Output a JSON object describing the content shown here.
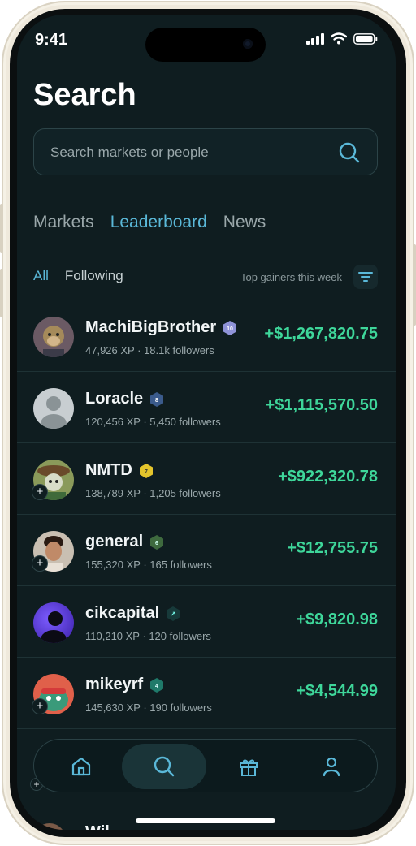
{
  "status": {
    "time": "9:41"
  },
  "page": {
    "title": "Search"
  },
  "search": {
    "placeholder": "Search markets or people"
  },
  "tabs": [
    {
      "label": "Markets",
      "active": false
    },
    {
      "label": "Leaderboard",
      "active": true
    },
    {
      "label": "News",
      "active": false
    }
  ],
  "filters": [
    {
      "label": "All",
      "active": true
    },
    {
      "label": "Following",
      "active": false
    }
  ],
  "sort": {
    "label": "Top gainers this week"
  },
  "leaderboard": [
    {
      "name": "MachiBigBrother",
      "badge": "10",
      "badge_color": "#8f93d8",
      "xp": "47,926 XP",
      "followers": "18.1k followers",
      "gain": "+$1,267,820.75",
      "avatar_color": "#6b5a64",
      "follow_button": false
    },
    {
      "name": "Loracle",
      "badge": "8",
      "badge_color": "#3b5b8c",
      "xp": "120,456 XP",
      "followers": "5,450 followers",
      "gain": "+$1,115,570.50",
      "avatar_color": "#c8ced1",
      "follow_button": false
    },
    {
      "name": "NMTD",
      "badge": "7",
      "badge_color": "#e4c52c",
      "xp": "138,789 XP",
      "followers": "1,205 followers",
      "gain": "+$922,320.78",
      "avatar_color": "#8a9a5a",
      "follow_button": true
    },
    {
      "name": "general",
      "badge": "6",
      "badge_color": "#3e6a3e",
      "xp": "155,320 XP",
      "followers": "165 followers",
      "gain": "+$12,755.75",
      "avatar_color": "#b58566",
      "follow_button": true
    },
    {
      "name": "cikcapital",
      "badge": "↗",
      "badge_color": "#173a3a",
      "xp": "110,210 XP",
      "followers": "120 followers",
      "gain": "+$9,820.98",
      "avatar_color": "#5b3de0",
      "follow_button": false
    },
    {
      "name": "mikeyrf",
      "badge": "4",
      "badge_color": "#1f7a6a",
      "xp": "145,630 XP",
      "followers": "190 followers",
      "gain": "+$4,544.99",
      "avatar_color": "#e0604a",
      "follow_button": true
    }
  ],
  "nav": [
    {
      "icon": "home-icon",
      "active": false
    },
    {
      "icon": "search-icon",
      "active": true
    },
    {
      "icon": "gift-icon",
      "active": false
    },
    {
      "icon": "profile-icon",
      "active": false
    }
  ],
  "next_row_peek": {
    "name": "Wil"
  },
  "colors": {
    "accent": "#5ab8d8",
    "gain": "#3ed69a",
    "background": "#0f1d20"
  }
}
